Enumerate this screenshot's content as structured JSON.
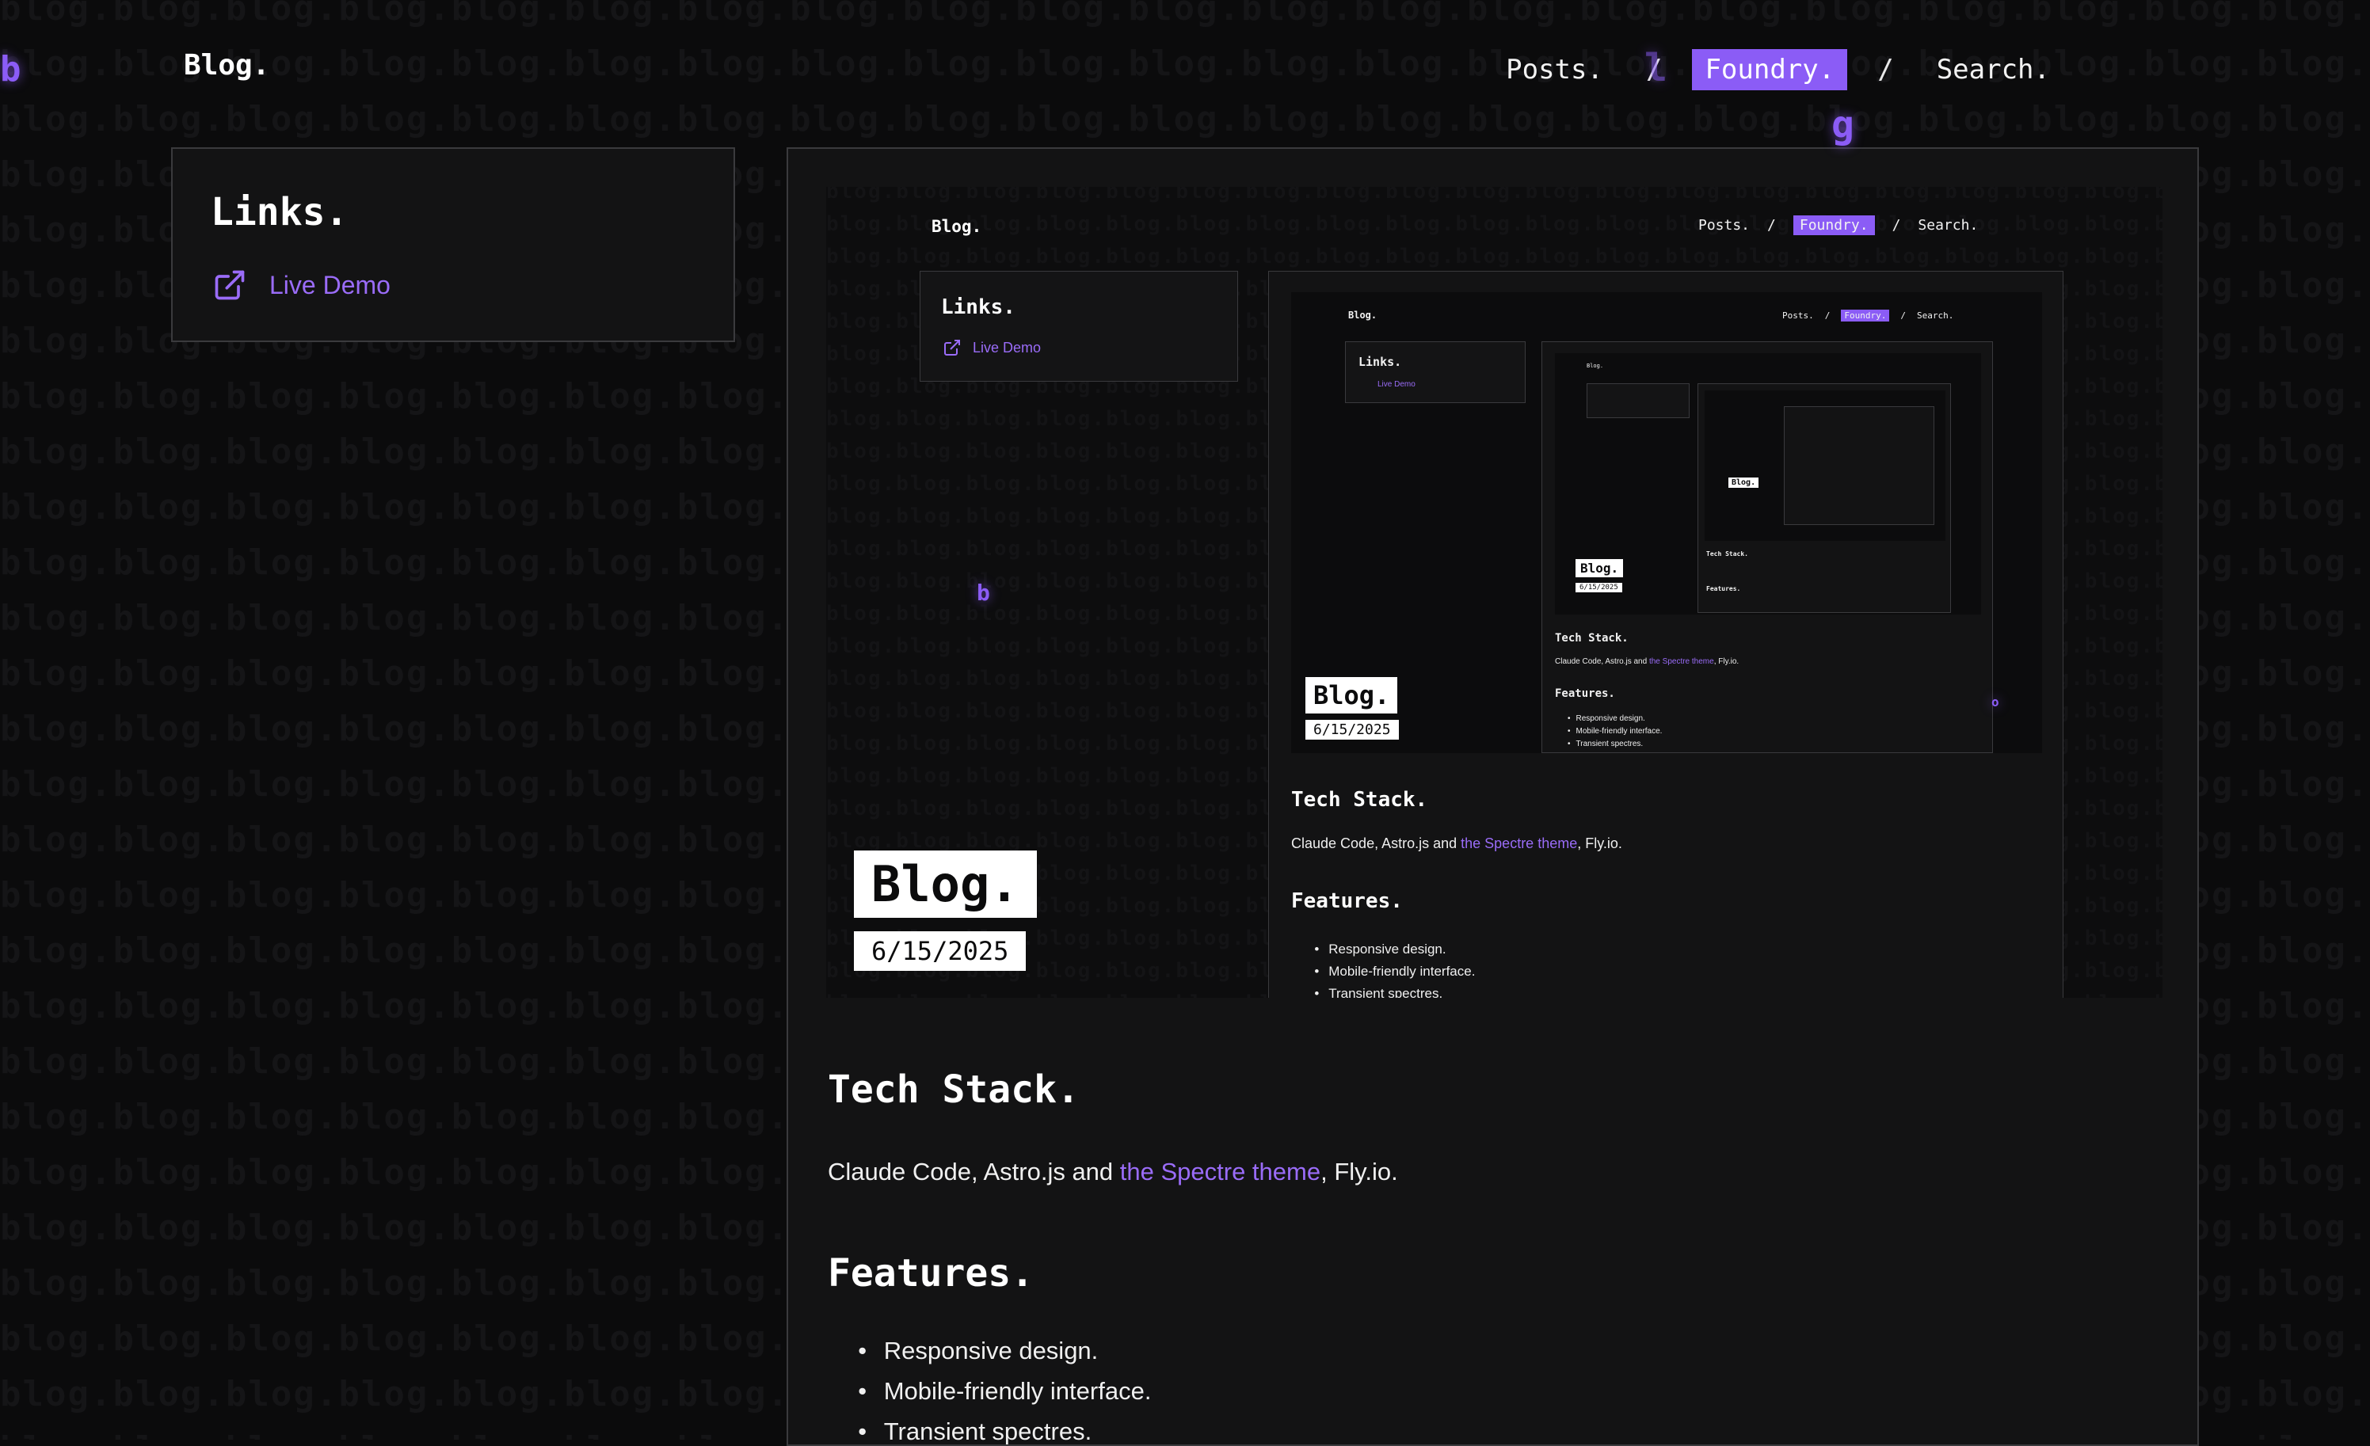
{
  "header": {
    "logo": "Blog.",
    "nav": [
      {
        "label": "Posts.",
        "active": false
      },
      {
        "label": "Foundry.",
        "active": true
      },
      {
        "label": "Search.",
        "active": false
      }
    ],
    "separator": "/"
  },
  "sidebar": {
    "title": "Links.",
    "links": [
      {
        "label": "Live Demo",
        "icon": "external-link-icon"
      }
    ]
  },
  "post": {
    "badge_title": "Blog.",
    "badge_date": "6/15/2025",
    "tech_heading": "Tech Stack.",
    "tech_text_before": "Claude Code, Astro.js and ",
    "tech_link": "the Spectre theme",
    "tech_text_after": ", Fly.io.",
    "features_heading": "Features.",
    "features": [
      "Responsive design.",
      "Mobile-friendly interface.",
      "Transient spectres."
    ]
  },
  "background": {
    "pattern_word": "blog.",
    "glyphs": [
      "b",
      "l",
      "g",
      "b",
      "o"
    ]
  },
  "colors": {
    "accent": "#8b5cf6",
    "link": "#9a6cf8",
    "background": "#0b0b0c",
    "card": "#131314",
    "border": "#3a3a3d"
  }
}
